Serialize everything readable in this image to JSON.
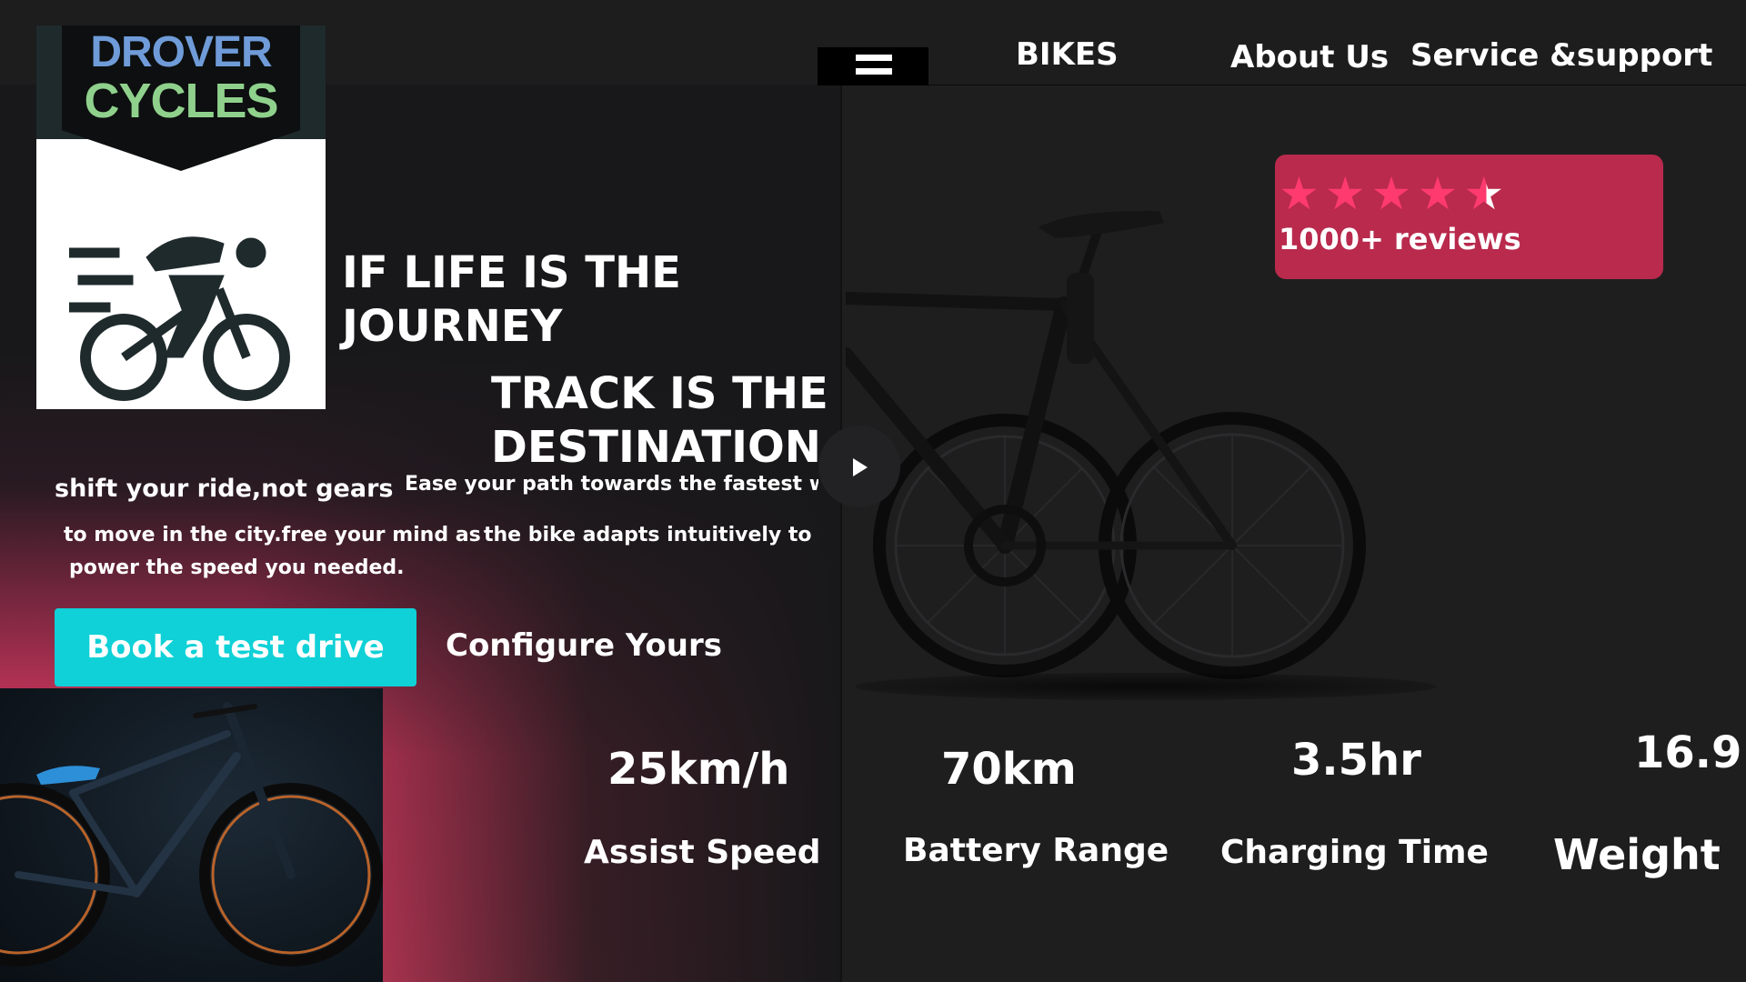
{
  "brand": {
    "logo_word1": "DROVER",
    "logo_word2": "CYCLES",
    "logo_icon": "cyclist-icon"
  },
  "nav": {
    "menu_icon": "hamburger-icon",
    "items": [
      "BIKES",
      "About Us",
      "Service &support"
    ]
  },
  "hero": {
    "headline_line1": "IF LIFE IS THE",
    "headline_line2": "JOURNEY",
    "headline_line3": "TRACK IS THE",
    "headline_line4": "DESTINATION",
    "tagline": "shift your ride,not gears",
    "body_line1": "Ease your path towards the fastest wa",
    "body_line2a": "to move in the city.free your mind as",
    "body_line2b": "the bike adapts intuitively to",
    "body_line3": "power the speed you needed.",
    "cta_primary": "Book a test drive",
    "cta_secondary": "Configure Yours",
    "play_icon": "play-icon"
  },
  "reviews": {
    "stars": 4.5,
    "label": "1000+ reviews",
    "color": "#b92a4d"
  },
  "stats": [
    {
      "value": "25km/h",
      "label": "Assist Speed"
    },
    {
      "value": "70km",
      "label": "Battery Range"
    },
    {
      "value": "3.5hr",
      "label": "Charging Time"
    },
    {
      "value": "16.9",
      "label": "Weight"
    }
  ],
  "colors": {
    "accent": "#0fd1d7",
    "pink": "#ee3f68",
    "background": "#1e1e1f"
  }
}
